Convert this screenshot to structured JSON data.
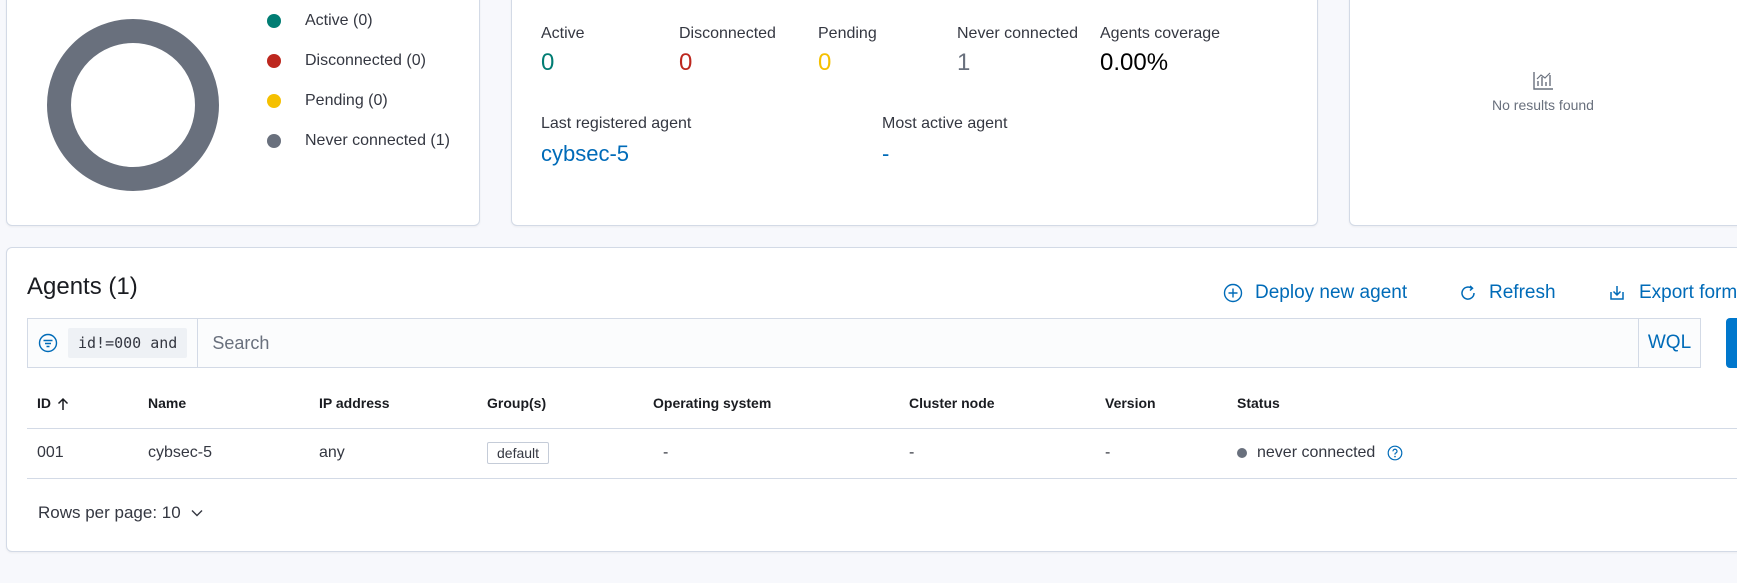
{
  "colors": {
    "active": "#017d73",
    "disconnected": "#bd271e",
    "pending": "#f5a700",
    "never_connected": "#69707d",
    "link": "#006bb8",
    "donut": "#69707d"
  },
  "status_chart": {
    "legend": [
      {
        "label": "Active (0)",
        "color": "#017d73"
      },
      {
        "label": "Disconnected (0)",
        "color": "#bd271e"
      },
      {
        "label": "Pending (0)",
        "color": "#f5c000"
      },
      {
        "label": "Never connected (1)",
        "color": "#69707d"
      }
    ]
  },
  "details": {
    "active": {
      "label": "Active",
      "value": "0"
    },
    "disconnected": {
      "label": "Disconnected",
      "value": "0"
    },
    "pending": {
      "label": "Pending",
      "value": "0"
    },
    "never_connected": {
      "label": "Never connected",
      "value": "1"
    },
    "coverage": {
      "label": "Agents coverage",
      "value": "0.00%"
    },
    "last_registered": {
      "label": "Last registered agent",
      "value": "cybsec-5"
    },
    "most_active": {
      "label": "Most active agent",
      "value": "-"
    }
  },
  "evolution": {
    "empty_text": "No results found",
    "icon": "chart-icon"
  },
  "agents": {
    "title": "Agents (1)",
    "actions": {
      "deploy": "Deploy new agent",
      "refresh": "Refresh",
      "export": "Export formatted"
    },
    "search": {
      "implicit_filter": "id!=000 and",
      "placeholder": "Search",
      "wql": "WQL"
    },
    "columns": [
      "ID",
      "Name",
      "IP address",
      "Group(s)",
      "Operating system",
      "Cluster node",
      "Version",
      "Status"
    ],
    "rows": [
      {
        "id": "001",
        "name": "cybsec-5",
        "ip": "any",
        "group": "default",
        "os": "-",
        "node": "-",
        "version": "-",
        "status": "never connected"
      }
    ],
    "rows_per_page": "Rows per page: 10"
  }
}
